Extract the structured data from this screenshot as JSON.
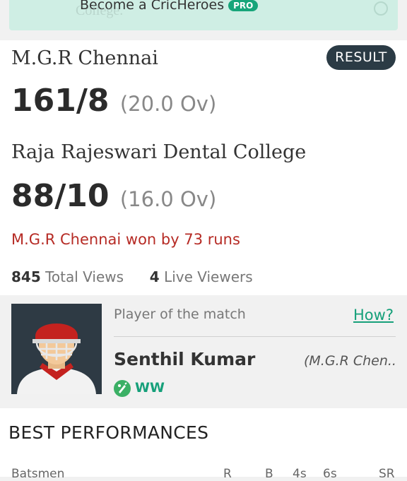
{
  "promo": {
    "text": "Become a CricHeroes",
    "badge": "PRO",
    "ghost_text": "College."
  },
  "match": {
    "team1": {
      "name": "M.G.R Chennai",
      "score": "161/8",
      "overs": "(20.0 Ov)"
    },
    "team2": {
      "name": "Raja Rajeswari Dental College",
      "score": "88/10",
      "overs": "(16.0 Ov)"
    },
    "status_badge": "RESULT",
    "result_text": "M.G.R Chennai won by 73 runs",
    "total_views": "845",
    "total_views_label": "Total Views",
    "live_viewers": "4",
    "live_viewers_label": "Live Viewers"
  },
  "potm": {
    "label": "Player of the match",
    "how_link": "How?",
    "player_name": "Senthil Kumar",
    "player_team": "(M.G.R Chen..",
    "role": "WW",
    "role_icon": "bat-ball-icon"
  },
  "best_performances": {
    "title": "BEST PERFORMANCES",
    "columns": [
      "Batsmen",
      "R",
      "B",
      "4s",
      "6s",
      "SR"
    ]
  },
  "colors": {
    "result_red": "#b62b25",
    "accent_green": "#16a07a",
    "badge_dark": "#2b3b45",
    "promo_bg": "#cfeee4"
  }
}
